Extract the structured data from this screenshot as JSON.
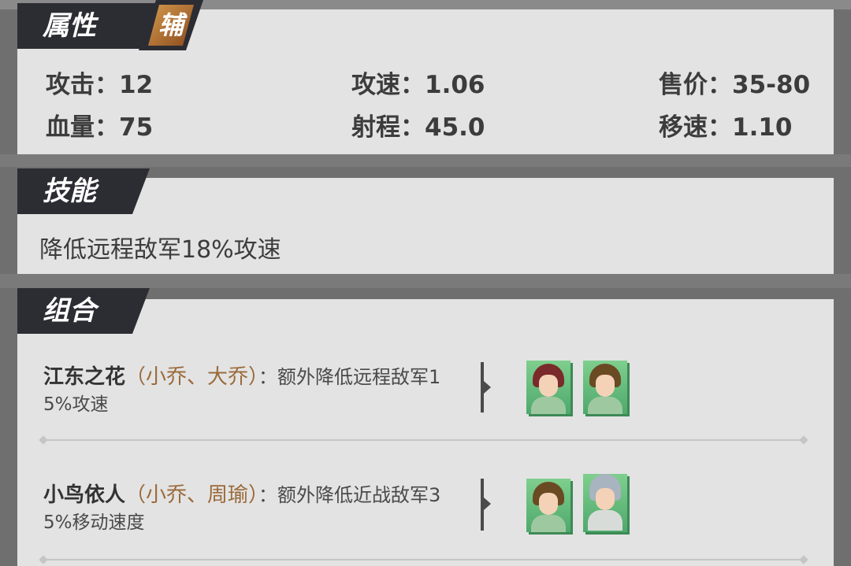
{
  "attributes": {
    "title": "属性",
    "role_badge": "辅",
    "stats": {
      "attack": "攻击：12",
      "attack_speed": "攻速：1.06",
      "price": "售价：35-80",
      "hp": "血量：75",
      "range": "射程：45.0",
      "move_speed": "移速：1.10"
    }
  },
  "skill": {
    "title": "技能",
    "description": "降低远程敌军18%攻速"
  },
  "combos": {
    "title": "组合",
    "items": [
      {
        "name": "江东之花",
        "members": "（小乔、大乔）",
        "desc_line1": "：额外降低远程敌军1",
        "desc_line2": "5%攻速",
        "portraits": [
          "portrait-xiaoqiao",
          "portrait-daqiao"
        ]
      },
      {
        "name": "小鸟依人",
        "members": "（小乔、周瑜）",
        "desc_line1": "：额外降低近战敌军3",
        "desc_line2": "5%移动速度",
        "portraits": [
          "portrait-xiaoqiao",
          "portrait-zhouyu"
        ]
      }
    ]
  },
  "colors": {
    "tab_bg": "#2c2c33",
    "panel_bg": "#e3e3e3",
    "member_text": "#9a6a3a",
    "badge_orange": "#c8823c"
  }
}
